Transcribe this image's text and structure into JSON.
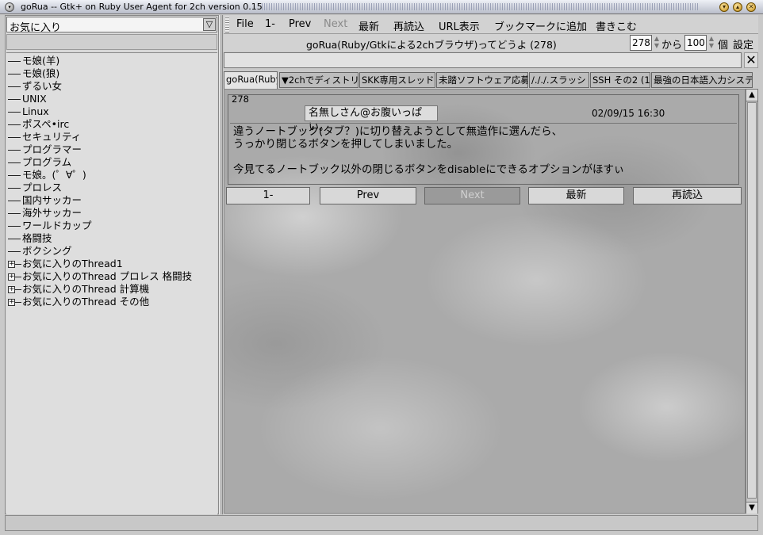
{
  "window": {
    "title": "goRua -- Gtk+ on Ruby User Agent for 2ch version 0.15"
  },
  "sidebar": {
    "combo_value": "お気に入り",
    "items": [
      {
        "label": "モ娘(羊)",
        "expandable": false
      },
      {
        "label": "モ娘(狼)",
        "expandable": false
      },
      {
        "label": "ずるい女",
        "expandable": false
      },
      {
        "label": "UNIX",
        "expandable": false
      },
      {
        "label": "Linux",
        "expandable": false
      },
      {
        "label": "ポスペ•irc",
        "expandable": false
      },
      {
        "label": "セキュリティ",
        "expandable": false
      },
      {
        "label": "プログラマー",
        "expandable": false
      },
      {
        "label": "プログラム",
        "expandable": false
      },
      {
        "label": "モ娘。(゜∀゜)",
        "expandable": false
      },
      {
        "label": "プロレス",
        "expandable": false
      },
      {
        "label": "国内サッカー",
        "expandable": false
      },
      {
        "label": "海外サッカー",
        "expandable": false
      },
      {
        "label": "ワールドカップ",
        "expandable": false
      },
      {
        "label": "格闘技",
        "expandable": false
      },
      {
        "label": "ボクシング",
        "expandable": false
      },
      {
        "label": "お気に入りのThread1",
        "expandable": true
      },
      {
        "label": "お気に入りのThread プロレス 格闘技",
        "expandable": true
      },
      {
        "label": "お気に入りのThread 計算機",
        "expandable": true
      },
      {
        "label": "お気に入りのThread その他",
        "expandable": true
      }
    ]
  },
  "menu": {
    "items": [
      "File",
      "1-",
      "Prev",
      "Next",
      "最新",
      "再読込",
      "URL表示",
      "ブックマークに追加",
      "書きこむ"
    ],
    "disabled": [
      "Next"
    ]
  },
  "thread": {
    "title": "goRua(Ruby/Gtkによる2chブラウザ)ってどうよ (278)",
    "from_value": "278",
    "from_label": "から",
    "count_value": "100",
    "count_label": "個",
    "settings_label": "設定"
  },
  "tabs": [
    {
      "label": "goRua(Ruby",
      "active": true
    },
    {
      "label": "▼2chでディストリ",
      "active": false
    },
    {
      "label": "SKK専用スレッド",
      "active": false
    },
    {
      "label": "未踏ソフトウェア応募",
      "active": false
    },
    {
      "label": "/././.スラッシ",
      "active": false
    },
    {
      "label": "SSH その2 (1",
      "active": false
    },
    {
      "label": "最強の日本語入力システ",
      "active": false
    }
  ],
  "post": {
    "number": "278",
    "name": "名無しさん@お腹いっぱい。",
    "date": "02/09/15 16:30",
    "lines": [
      "違うノートブック(タブ？)に切り替えようとして無造作に選んだら、",
      "うっかり閉じるボタンを押してしまいました。",
      "",
      "今見てるノートブック以外の閉じるボタンをdisableにできるオプションがほすぃ"
    ]
  },
  "nav": {
    "first": "1-",
    "prev": "Prev",
    "next": "Next",
    "latest": "最新",
    "reload": "再読込"
  },
  "icons": {
    "window_menu": "window-menu-icon",
    "minimize": "minimize-icon",
    "maximize": "maximize-icon",
    "close": "close-icon"
  }
}
